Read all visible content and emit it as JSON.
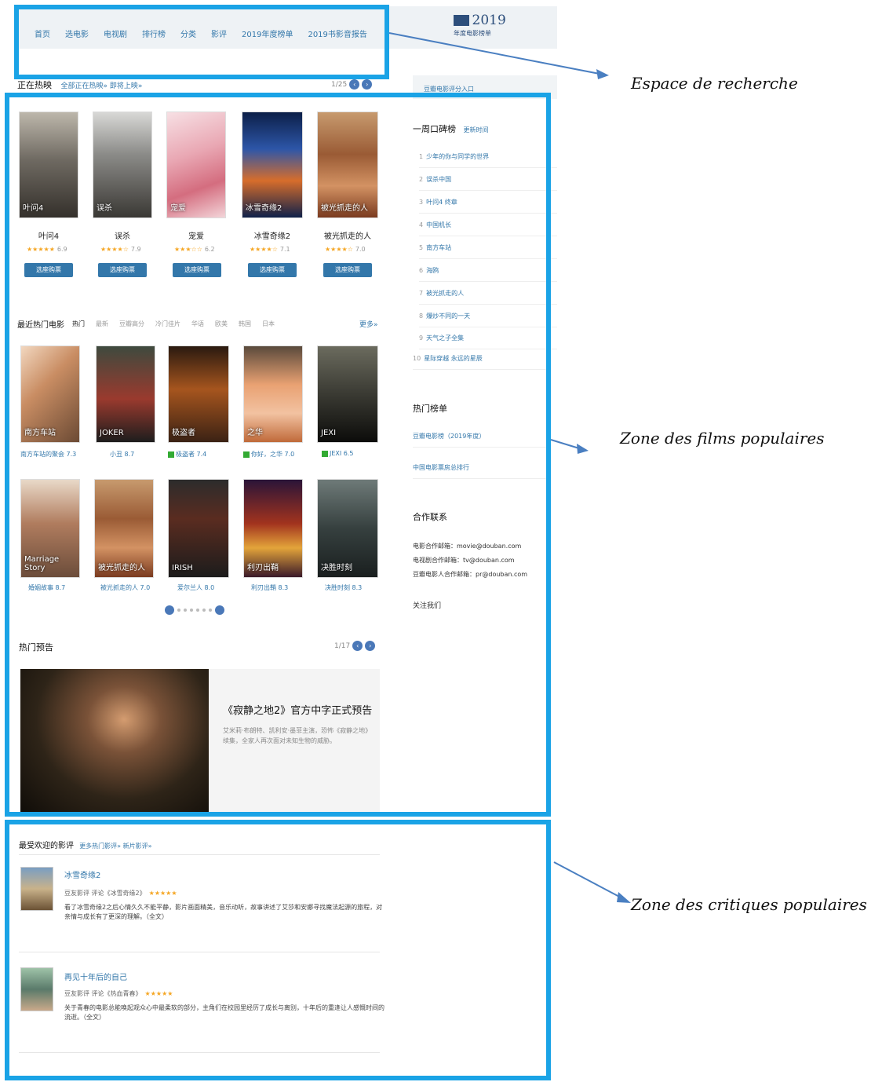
{
  "nav": {
    "items": [
      "首页",
      "选电影",
      "电视剧",
      "排行榜",
      "分类",
      "影评",
      "2019年度榜单",
      "2019书影音报告"
    ],
    "logo_year": "2019",
    "logo_sub": "年度电影榜单"
  },
  "annotations": {
    "search": "Espace de recherche",
    "films": "Zone des films populaires",
    "critiques": "Zone des critiques populaires"
  },
  "now_playing": {
    "title": "正在热映",
    "links": "全部正在热映» 即将上映»",
    "pager": "1/25",
    "movies": [
      {
        "title": "叶问4",
        "score": "6.9",
        "stars": "★★★★★",
        "btn": "选座购票",
        "poster_text": "叶问4"
      },
      {
        "title": "误杀",
        "score": "7.9",
        "stars": "★★★★☆",
        "btn": "选座购票",
        "poster_text": "误杀"
      },
      {
        "title": "宠爱",
        "score": "6.2",
        "stars": "★★★☆☆",
        "btn": "选座购票",
        "poster_text": "宠爱"
      },
      {
        "title": "冰雪奇缘2",
        "score": "7.1",
        "stars": "★★★★☆",
        "btn": "选座购票",
        "poster_text": "冰雪奇缘2"
      },
      {
        "title": "被光抓走的人",
        "score": "7.0",
        "stars": "★★★★☆",
        "btn": "选座购票",
        "poster_text": "被光抓走的人"
      }
    ]
  },
  "hot": {
    "title": "最近热门电影",
    "tabs": [
      "热门",
      "最新",
      "豆瓣高分",
      "冷门佳片",
      "华语",
      "欧美",
      "韩国",
      "日本"
    ],
    "more": "更多»",
    "row1": [
      {
        "caption": "南方车站的聚会 7.3",
        "poster_text": "南方车站"
      },
      {
        "caption": "小丑 8.7",
        "poster_text": "JOKER"
      },
      {
        "caption": "极盗者 7.4",
        "poster_text": "极盗者",
        "tag": true
      },
      {
        "caption": "你好，之华 7.0",
        "poster_text": "之华",
        "tag": true
      },
      {
        "caption": "JEXI 6.5",
        "poster_text": "JEXI",
        "tag": true
      }
    ],
    "row2": [
      {
        "caption": "婚姻故事 8.7",
        "poster_text": "Marriage Story"
      },
      {
        "caption": "被光抓走的人 7.0",
        "poster_text": "被光抓走的人"
      },
      {
        "caption": "爱尔兰人 8.0",
        "poster_text": "IRISH"
      },
      {
        "caption": "利刃出鞘 8.3",
        "poster_text": "利刃出鞘"
      },
      {
        "caption": "决胜时刻 8.3",
        "poster_text": "决胜时刻"
      }
    ]
  },
  "trailers": {
    "title": "热门预告",
    "pager": "1/17",
    "card_title": "《寂静之地2》官方中字正式预告",
    "card_desc": "艾米莉·布朗特、凯利安·墨菲主演，恐怖《寂静之地》续集，全家人再次面对未知生物的威胁。"
  },
  "sidebar": {
    "search_hint": "豆瓣电影评分入口",
    "weekly_title": "一周口碑榜",
    "weekly_more": "更新时间",
    "weekly": [
      {
        "rank": "1",
        "name": "少年的你与同学的世界"
      },
      {
        "rank": "2",
        "name": "误杀中国"
      },
      {
        "rank": "3",
        "name": "叶问4 终章"
      },
      {
        "rank": "4",
        "name": "中国机长"
      },
      {
        "rank": "5",
        "name": "南方车站"
      },
      {
        "rank": "6",
        "name": "海鸥"
      },
      {
        "rank": "7",
        "name": "被光抓走的人"
      },
      {
        "rank": "8",
        "name": "爆炒不同的一天"
      },
      {
        "rank": "9",
        "name": "天气之子全集"
      },
      {
        "rank": "10",
        "name": "星际穿越 永远的星辰"
      }
    ],
    "cat_title": "热门榜单",
    "cats": [
      "豆瓣电影榜（2019年度）",
      "中国电影票房总排行"
    ],
    "coop_title": "合作联系",
    "coop": [
      "电影合作邮箱：movie@douban.com",
      "电视剧合作邮箱：tv@douban.com",
      "豆瓣电影人合作邮箱：pr@douban.com"
    ],
    "follow": "关注我们"
  },
  "reviews": {
    "title": "最受欢迎的影评",
    "links": "更多热门影评» 新片影评»",
    "items": [
      {
        "title": "冰雪奇缘2",
        "meta": "豆友影评 评论《冰雪奇缘2》",
        "stars": "★★★★★",
        "body": "看了冰雪奇缘2之后心情久久不能平静，影片画面精美，音乐动听，故事讲述了艾莎和安娜寻找魔法起源的旅程，对亲情与成长有了更深的理解。（全文）"
      },
      {
        "title": "再见十年后的自己",
        "meta": "豆友影评 评论《热血青春》",
        "stars": "★★★★★",
        "body": "关于青春的电影总能唤起观众心中最柔软的部分，主角们在校园里经历了成长与离别，十年后的重逢让人感慨时间的流逝。（全文）"
      }
    ]
  }
}
